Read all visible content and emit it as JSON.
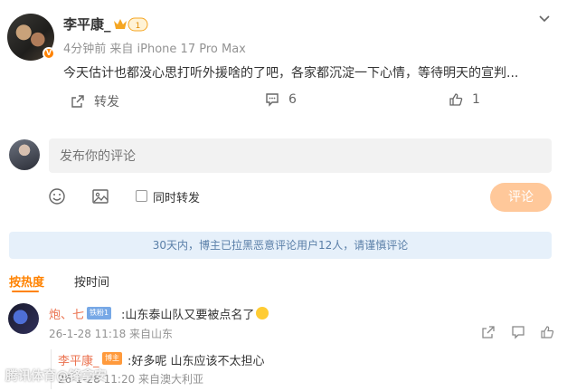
{
  "post": {
    "author": "李平康_",
    "meta": "4分钟前 来自 iPhone 17 Pro Max",
    "text": "今天估计也都没心思打听外援啥的了吧，各家都沉淀一下心情，等待明天的宣判...",
    "verified_mark": "V",
    "crown_level": "1"
  },
  "actions": {
    "repost_label": "转发",
    "comment_count": "6",
    "like_count": "1"
  },
  "composer": {
    "placeholder": "发布你的评论",
    "also_repost_label": "同时转发",
    "submit_label": "评论"
  },
  "notice": "30天内，博主已拉黑恶意评论用户12人，请谨慎评论",
  "sort": {
    "hot_label": "按热度",
    "time_label": "按时间"
  },
  "comments": [
    {
      "name": "炮、七",
      "badge": "铁粉1",
      "text": ":山东泰山队又要被点名了",
      "meta": "26-1-28 11:18 来自山东"
    }
  ],
  "reply": {
    "name": "李平康_",
    "badge": "博主",
    "text": ":好多呢 山东应该不太担心",
    "meta": "26-1-28 11:20 来自澳大利亚"
  },
  "watermark": "腾讯体育@锋拿安",
  "colors": {
    "accent": "#ff8200",
    "username": "#eb7350",
    "notice_bg": "#e6f0fa",
    "notice_text": "#5a7fa8",
    "submit_disabled": "#ffc89a"
  },
  "icons": [
    "chevron-down-icon",
    "repost-icon",
    "comment-icon",
    "like-icon",
    "emoji-icon",
    "image-icon",
    "share-icon",
    "comment-icon",
    "like-icon"
  ]
}
